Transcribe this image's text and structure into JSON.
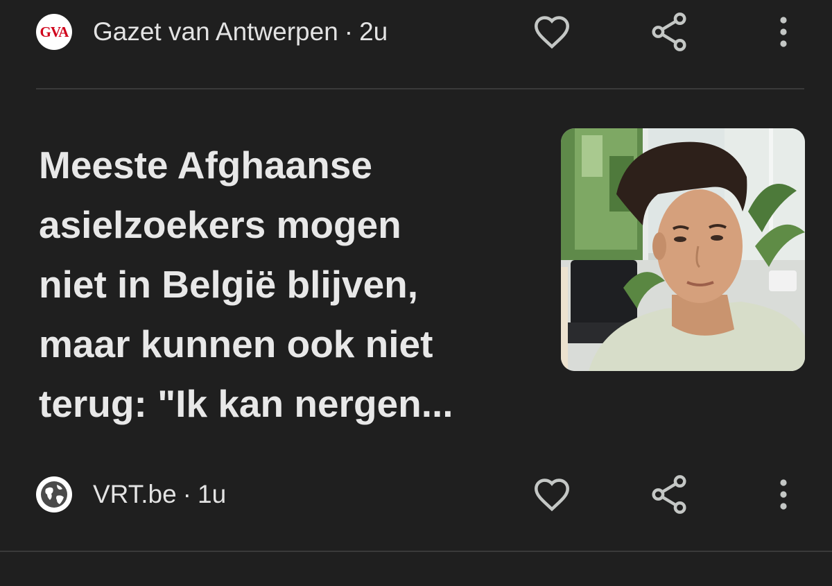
{
  "top_card": {
    "source_logo_text": "GVA",
    "source_name": "Gazet van Antwerpen",
    "separator": "·",
    "age": "2u"
  },
  "article": {
    "headline_lines": [
      "Meeste Afghaanse",
      "asielzoekers mogen",
      "niet in België blijven,",
      "maar kunnen ook niet",
      "terug: \"Ik kan nergen..."
    ],
    "source_name": "VRT.be",
    "separator": "·",
    "age": "1u"
  },
  "icons": {
    "favorite": "heart-outline-icon",
    "share": "share-icon",
    "more": "more-vert-icon",
    "source_fallback": "globe-icon"
  },
  "colors": {
    "background": "#1f1f1f",
    "text": "#e3e3e3",
    "icon": "#c4c7c5",
    "divider": "#3a3a3a",
    "gva_red": "#d0021b"
  }
}
